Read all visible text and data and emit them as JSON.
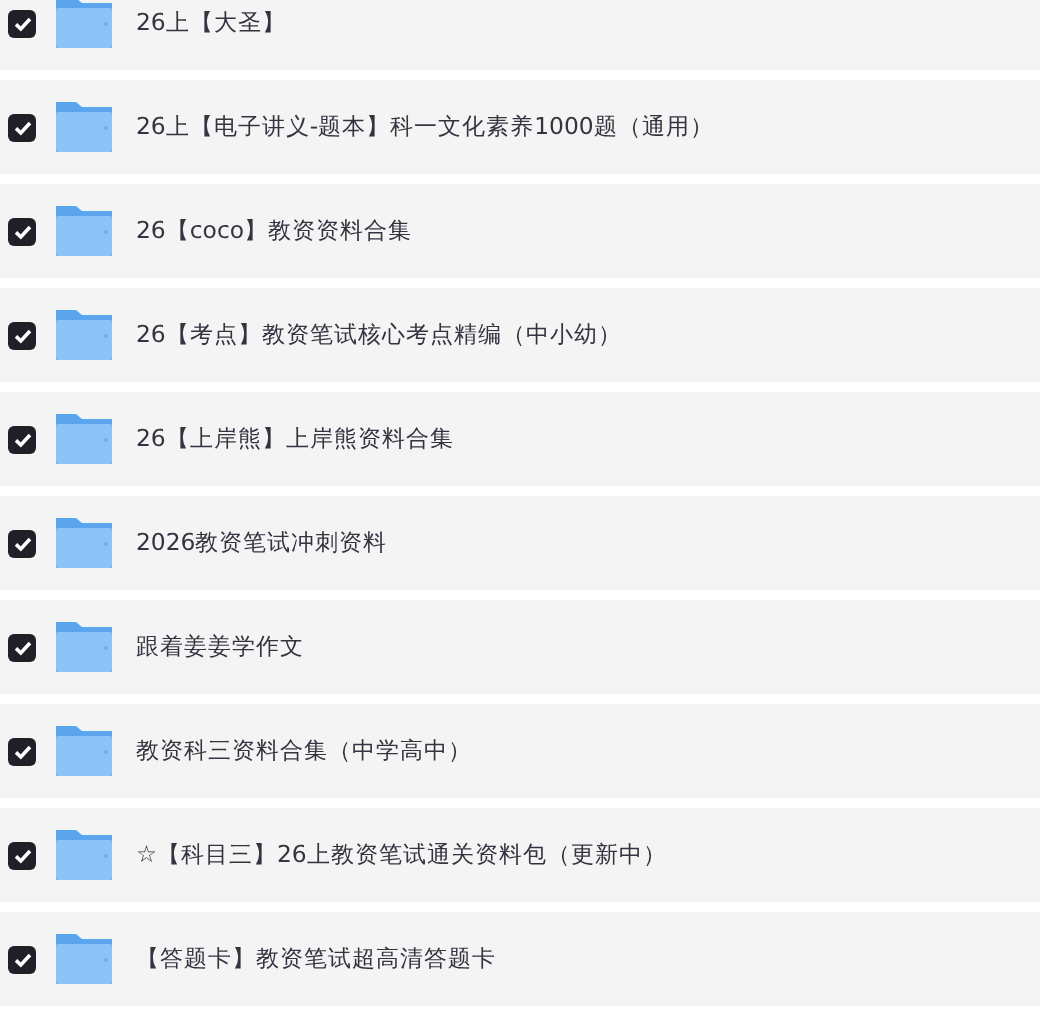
{
  "files": [
    {
      "name": "26上【大圣】",
      "checked": true
    },
    {
      "name": "26上【电子讲义-题本】科一文化素养1000题（通用）",
      "checked": true
    },
    {
      "name": "26【coco】教资资料合集",
      "checked": true
    },
    {
      "name": "26【考点】教资笔试核心考点精编（中小幼）",
      "checked": true
    },
    {
      "name": "26【上岸熊】上岸熊资料合集",
      "checked": true
    },
    {
      "name": "2026教资笔试冲刺资料",
      "checked": true
    },
    {
      "name": "跟着姜姜学作文",
      "checked": true
    },
    {
      "name": "教资科三资料合集（中学高中）",
      "checked": true
    },
    {
      "name": "☆【科目三】26上教资笔试通关资料包（更新中）",
      "checked": true
    },
    {
      "name": "【答题卡】教资笔试超高清答题卡",
      "checked": true
    }
  ]
}
